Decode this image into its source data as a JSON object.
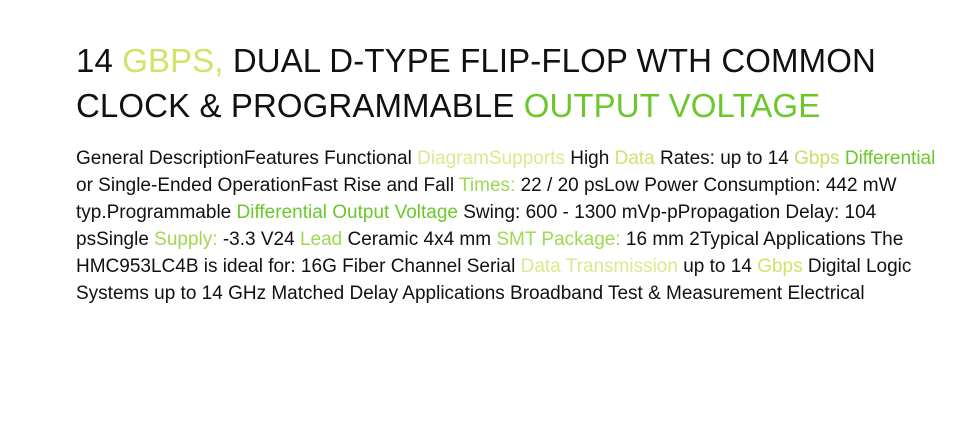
{
  "title": {
    "segments": [
      {
        "text": "14 ",
        "color": "#111111"
      },
      {
        "text": "GBPS,",
        "color": "#d2e36a"
      },
      {
        "text": " DUAL D-TYPE FLIP-FLOP WTH COMMON CLOCK & PROGRAMMABLE ",
        "color": "#111111"
      },
      {
        "text": "OUTPUT VOLTAGE",
        "color": "#6cc72a"
      }
    ]
  },
  "body": {
    "segments": [
      {
        "text": "General DescriptionFeatures Functional ",
        "color": "#111111"
      },
      {
        "text": "DiagramSupports",
        "color": "#dbe98c"
      },
      {
        "text": " High ",
        "color": "#111111"
      },
      {
        "text": "Data",
        "color": "#d2e36a"
      },
      {
        "text": " Rates: up to 14 ",
        "color": "#111111"
      },
      {
        "text": "Gbps",
        "color": "#c4e06a"
      },
      {
        "text": " ",
        "color": "#111111"
      },
      {
        "text": "Differential",
        "color": "#6cc72a"
      },
      {
        "text": " or Single-Ended OperationFast Rise and Fall ",
        "color": "#111111"
      },
      {
        "text": "Times:",
        "color": "#9ed94f"
      },
      {
        "text": " 22 / 20 psLow Power Consumption: 442 mW typ.Programmable ",
        "color": "#111111"
      },
      {
        "text": "Differential Output Voltage",
        "color": "#6cc72a"
      },
      {
        "text": " Swing: 600 - 1300 mVp-pPropagation Delay: 104 psSingle ",
        "color": "#111111"
      },
      {
        "text": "Supply:",
        "color": "#9ed94f"
      },
      {
        "text": " -3.3 V24 ",
        "color": "#111111"
      },
      {
        "text": "Lead",
        "color": "#9ed94f"
      },
      {
        "text": " Ceramic 4x4 mm ",
        "color": "#111111"
      },
      {
        "text": "SMT Package:",
        "color": "#9ed94f"
      },
      {
        "text": " 16 mm 2Typical Applications The HMC953LC4B is ideal for: 16G Fiber Channel Serial ",
        "color": "#111111"
      },
      {
        "text": "Data Transmission",
        "color": "#dbe98c"
      },
      {
        "text": " up to 14 ",
        "color": "#111111"
      },
      {
        "text": "Gbps",
        "color": "#d2e36a"
      },
      {
        "text": " Digital Logic Systems up to 14 GHz Matched Delay Applications Broadband Test & Measurement Electrical",
        "color": "#111111"
      }
    ]
  }
}
